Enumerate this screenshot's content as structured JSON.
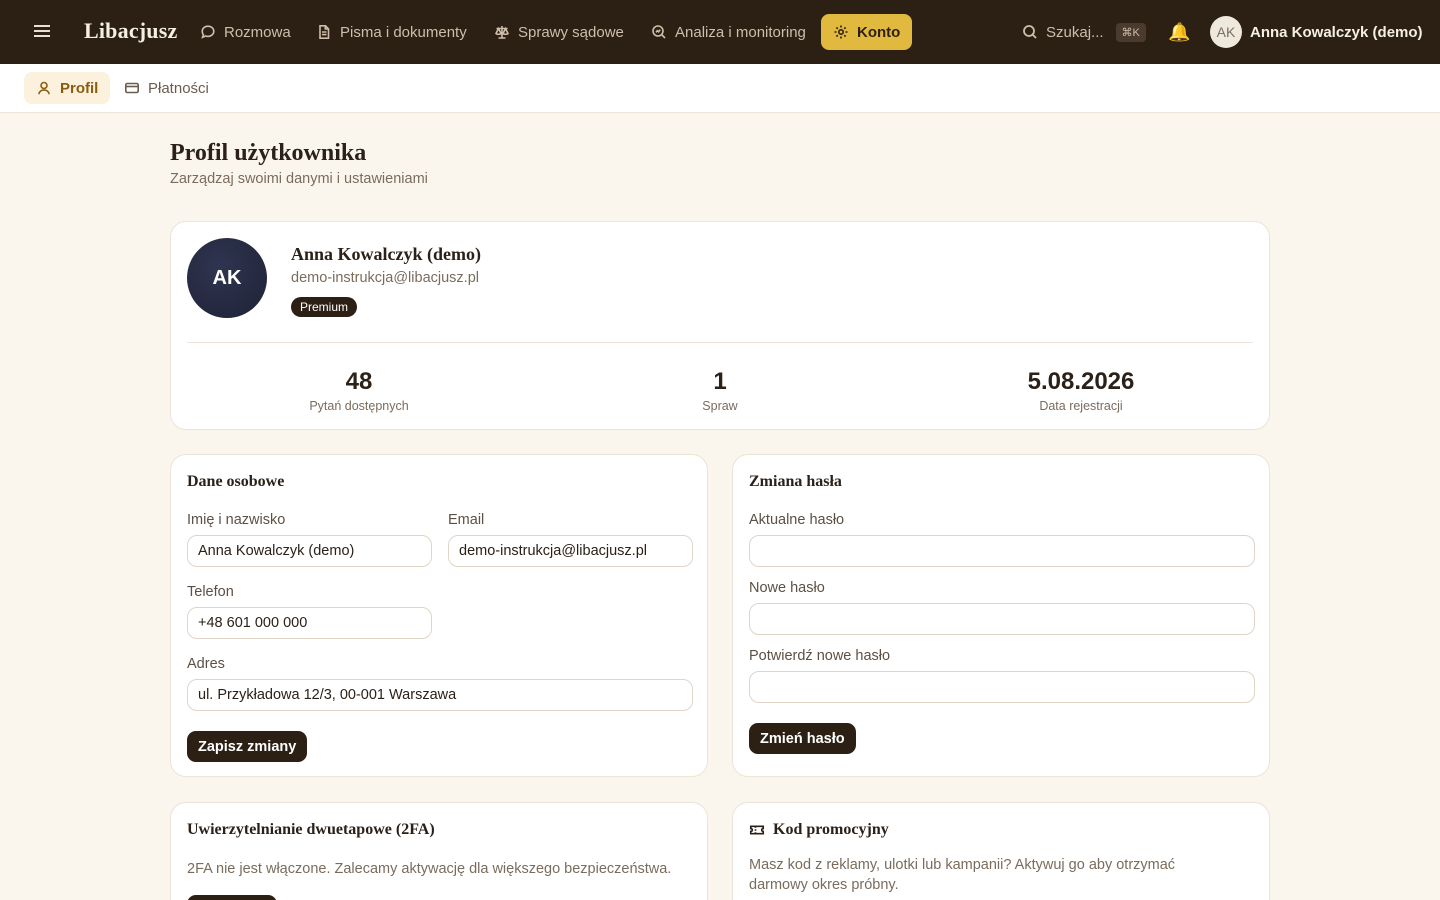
{
  "app": {
    "brand": "Libacjusz"
  },
  "nav": {
    "items": [
      {
        "label": "Rozmowa",
        "icon": "chat-bubble-icon"
      },
      {
        "label": "Pisma i dokumenty",
        "icon": "document-icon"
      },
      {
        "label": "Sprawy sądowe",
        "icon": "scales-icon"
      },
      {
        "label": "Analiza i monitoring",
        "icon": "search-chart-icon"
      },
      {
        "label": "Konto",
        "icon": "gear-icon",
        "active": true
      }
    ],
    "search_label": "Szukaj...",
    "search_shortcut": "⌘K",
    "user_initials": "AK",
    "user_name": "Anna Kowalczyk (demo)"
  },
  "subnav": {
    "tabs": [
      {
        "label": "Profil",
        "icon": "user-icon",
        "active": true
      },
      {
        "label": "Płatności",
        "icon": "credit-card-icon"
      }
    ]
  },
  "page": {
    "title": "Profil użytkownika",
    "subtitle": "Zarządzaj swoimi danymi i ustawieniami"
  },
  "profile": {
    "initials": "AK",
    "name": "Anna Kowalczyk (demo)",
    "email": "demo-instrukcja@libacjusz.pl",
    "badge": "Premium",
    "stats": [
      {
        "value": "48",
        "label": "Pytań dostępnych"
      },
      {
        "value": "1",
        "label": "Spraw"
      },
      {
        "value": "5.08.2026",
        "label": "Data rejestracji"
      }
    ]
  },
  "personal": {
    "title": "Dane osobowe",
    "name_label": "Imię i nazwisko",
    "name_value": "Anna Kowalczyk (demo)",
    "email_label": "Email",
    "email_value": "demo-instrukcja@libacjusz.pl",
    "phone_label": "Telefon",
    "phone_value": "+48 601 000 000",
    "address_label": "Adres",
    "address_value": "ul. Przykładowa 12/3, 00-001 Warszawa",
    "save_label": "Zapisz zmiany"
  },
  "password": {
    "title": "Zmiana hasła",
    "current_label": "Aktualne hasło",
    "new_label": "Nowe hasło",
    "confirm_label": "Potwierdź nowe hasło",
    "submit_label": "Zmień hasło"
  },
  "twofa": {
    "title": "Uwierzytelnianie dwuetapowe (2FA)",
    "description": "2FA nie jest włączone. Zalecamy aktywację dla większego bezpieczeństwa."
  },
  "promo": {
    "title": "Kod promocyjny",
    "icon": "ticket-icon",
    "description_line1": "Masz kod z reklamy, ulotki lub kampanii? Aktywuj go aby otrzymać",
    "description_line2": "darmowy okres próbny."
  },
  "colors": {
    "topbar": "#2c1f14",
    "accent": "#e1b93f",
    "background": "#faf6ee",
    "dark_button": "#2c1f14"
  }
}
